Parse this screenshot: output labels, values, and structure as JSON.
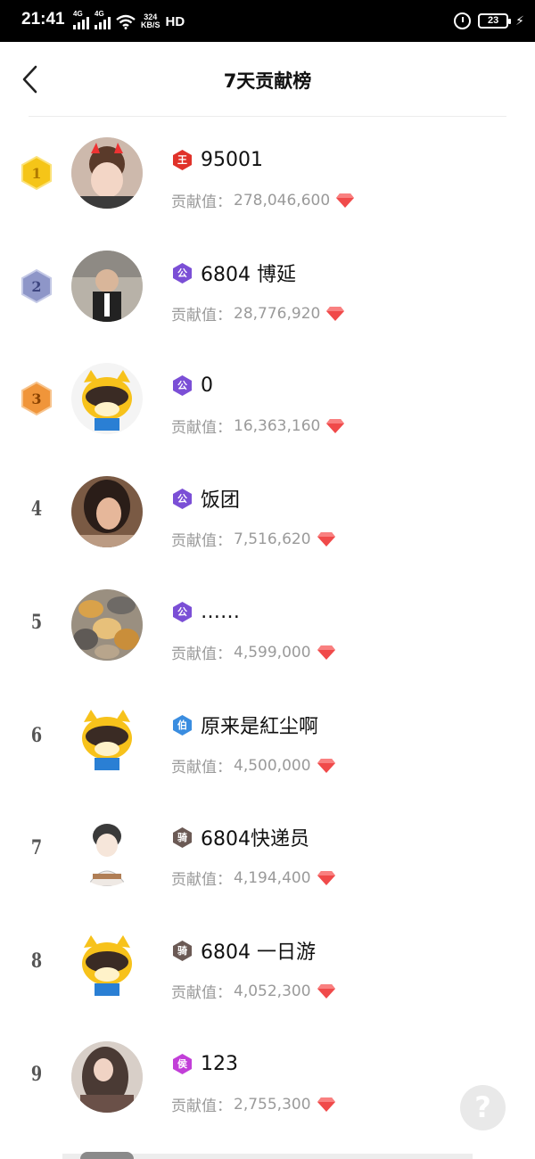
{
  "status_bar": {
    "time": "21:41",
    "network_1": "4G",
    "network_2": "4G",
    "speed_value": "324",
    "speed_unit": "KB/S",
    "hd": "HD",
    "battery": "23"
  },
  "header": {
    "title": "7天贡献榜",
    "back_icon": "chevron-left-icon"
  },
  "contribution_label": "贡献值：",
  "colors": {
    "gold": "#f5c518",
    "silver": "#8e96c8",
    "bronze": "#f0953a",
    "gem": "#f04a4a"
  },
  "rows": [
    {
      "rank": "1",
      "badge": "rank-gold-icon",
      "level_icon": "王",
      "level_color": "#e0322a",
      "name": "95001",
      "value": "278,046,600"
    },
    {
      "rank": "2",
      "badge": "rank-silver-icon",
      "level_icon": "公",
      "level_color": "#7b4fd6",
      "name": "6804 博延",
      "value": "28,776,920"
    },
    {
      "rank": "3",
      "badge": "rank-bronze-icon",
      "level_icon": "公",
      "level_color": "#7b4fd6",
      "name": "0",
      "value": "16,363,160"
    },
    {
      "rank": "4",
      "badge": "",
      "level_icon": "公",
      "level_color": "#7b4fd6",
      "name": "饭团",
      "value": "7,516,620"
    },
    {
      "rank": "5",
      "badge": "",
      "level_icon": "公",
      "level_color": "#7b4fd6",
      "name": "……",
      "value": "4,599,000"
    },
    {
      "rank": "6",
      "badge": "",
      "level_icon": "伯",
      "level_color": "#3a8de0",
      "name": "原来是紅尘啊",
      "value": "4,500,000"
    },
    {
      "rank": "7",
      "badge": "",
      "level_icon": "骑",
      "level_color": "#6b5a55",
      "name": "6804快递员",
      "value": "4,194,400"
    },
    {
      "rank": "8",
      "badge": "",
      "level_icon": "骑",
      "level_color": "#6b5a55",
      "name": "6804 一日游",
      "value": "4,052,300"
    },
    {
      "rank": "9",
      "badge": "",
      "level_icon": "侯",
      "level_color": "#c23fd8",
      "name": "123",
      "value": "2,755,300"
    }
  ],
  "help_button": "?"
}
